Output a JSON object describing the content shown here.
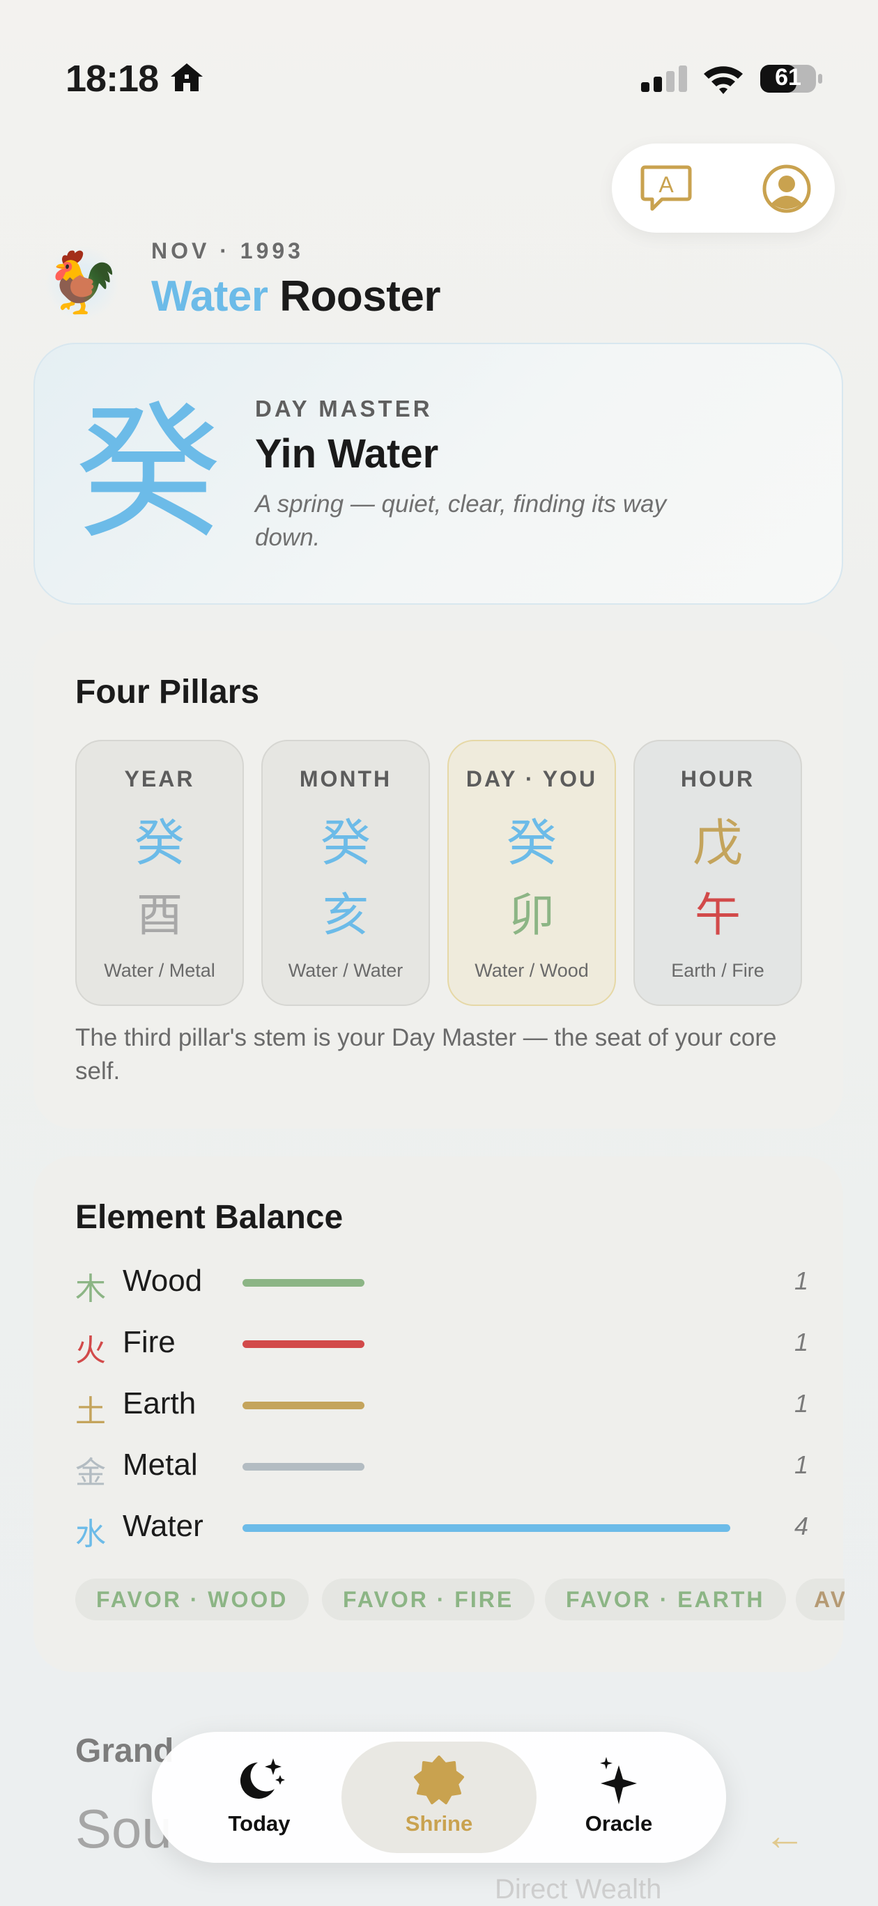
{
  "status_bar": {
    "time": "18:18",
    "battery": "61"
  },
  "header": {
    "zodiac_emoji": "🐓",
    "date": "NOV · 1993",
    "element": "Water",
    "animal": "Rooster"
  },
  "day_master": {
    "glyph": "癸",
    "label": "DAY MASTER",
    "name": "Yin Water",
    "description": "A spring — quiet, clear, finding its way down."
  },
  "pillars": {
    "title": "Four Pillars",
    "items": [
      {
        "label": "YEAR",
        "stem": "癸",
        "branch": "酉",
        "elements": "Water / Metal",
        "stem_color": "#6cbbe8",
        "branch_color": "#a8a8a8"
      },
      {
        "label": "MONTH",
        "stem": "癸",
        "branch": "亥",
        "elements": "Water / Water",
        "stem_color": "#6cbbe8",
        "branch_color": "#6cbbe8"
      },
      {
        "label": "DAY · YOU",
        "stem": "癸",
        "branch": "卯",
        "elements": "Water / Wood",
        "stem_color": "#6cbbe8",
        "branch_color": "#8cb585"
      },
      {
        "label": "HOUR",
        "stem": "戊",
        "branch": "午",
        "elements": "Earth / Fire",
        "stem_color": "#c4a45c",
        "branch_color": "#d24a4a"
      }
    ],
    "note": "The third pillar's stem is your Day Master — the seat of your core self."
  },
  "element_balance": {
    "title": "Element Balance",
    "max": 4,
    "items": [
      {
        "glyph": "木",
        "name": "Wood",
        "count": "1",
        "value": 1,
        "color": "#8cb585"
      },
      {
        "glyph": "火",
        "name": "Fire",
        "count": "1",
        "value": 1,
        "color": "#d24a4a"
      },
      {
        "glyph": "土",
        "name": "Earth",
        "count": "1",
        "value": 1,
        "color": "#c4a45c"
      },
      {
        "glyph": "金",
        "name": "Metal",
        "count": "1",
        "value": 1,
        "color": "#b3bcc2"
      },
      {
        "glyph": "水",
        "name": "Water",
        "count": "4",
        "value": 4,
        "color": "#6cbbe8"
      }
    ],
    "chips": [
      "FAVOR · WOOD",
      "FAVOR · FIRE",
      "FAVOR · EARTH",
      "AV"
    ]
  },
  "next_section": {
    "title": "Grand",
    "value": "Sou",
    "sub": "Direct Wealth"
  },
  "tabbar": {
    "today": "Today",
    "shrine": "Shrine",
    "oracle": "Oracle"
  }
}
